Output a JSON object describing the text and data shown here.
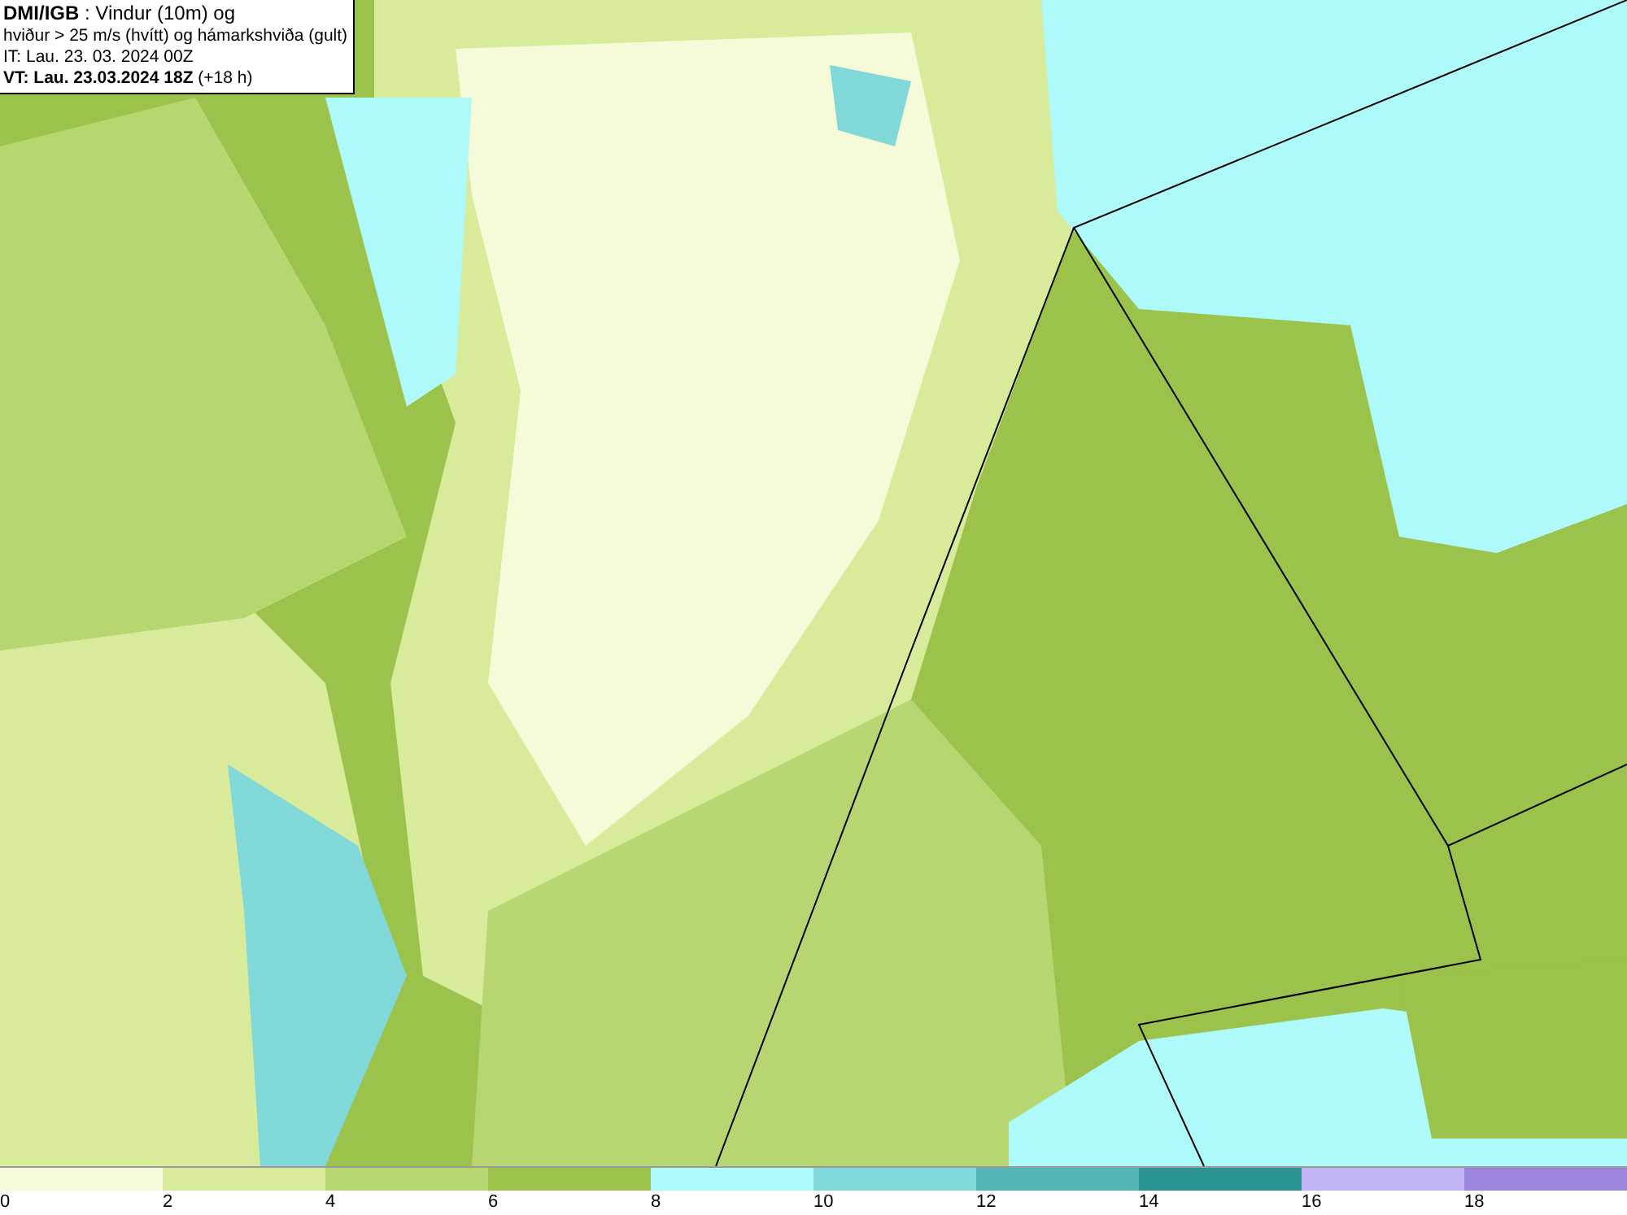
{
  "title_box": {
    "lines": [
      "**DMI/IGB** : Vindur (10m) og",
      "hviður > 25 m/s (hvítt) og hámarkshviða (gult)",
      "IT: Lau. 23. 03. 2024 00Z",
      "**VT: Lau. 23.03.2024 18Z** (+18 h)"
    ]
  },
  "legend": {
    "bins": [
      {
        "label": "0",
        "color": "#f5fad8"
      },
      {
        "label": "2",
        "color": "#d7eb9a"
      },
      {
        "label": "4",
        "color": "#b5d670"
      },
      {
        "label": "6",
        "color": "#9bc24a"
      },
      {
        "label": "8",
        "color": "#aefafa"
      },
      {
        "label": "10",
        "color": "#80d8d8"
      },
      {
        "label": "12",
        "color": "#55b5b5"
      },
      {
        "label": "14",
        "color": "#2a9494"
      },
      {
        "label": "16",
        "color": "#c3b4f5"
      },
      {
        "label": "18",
        "color": "#9b85dd"
      }
    ]
  }
}
